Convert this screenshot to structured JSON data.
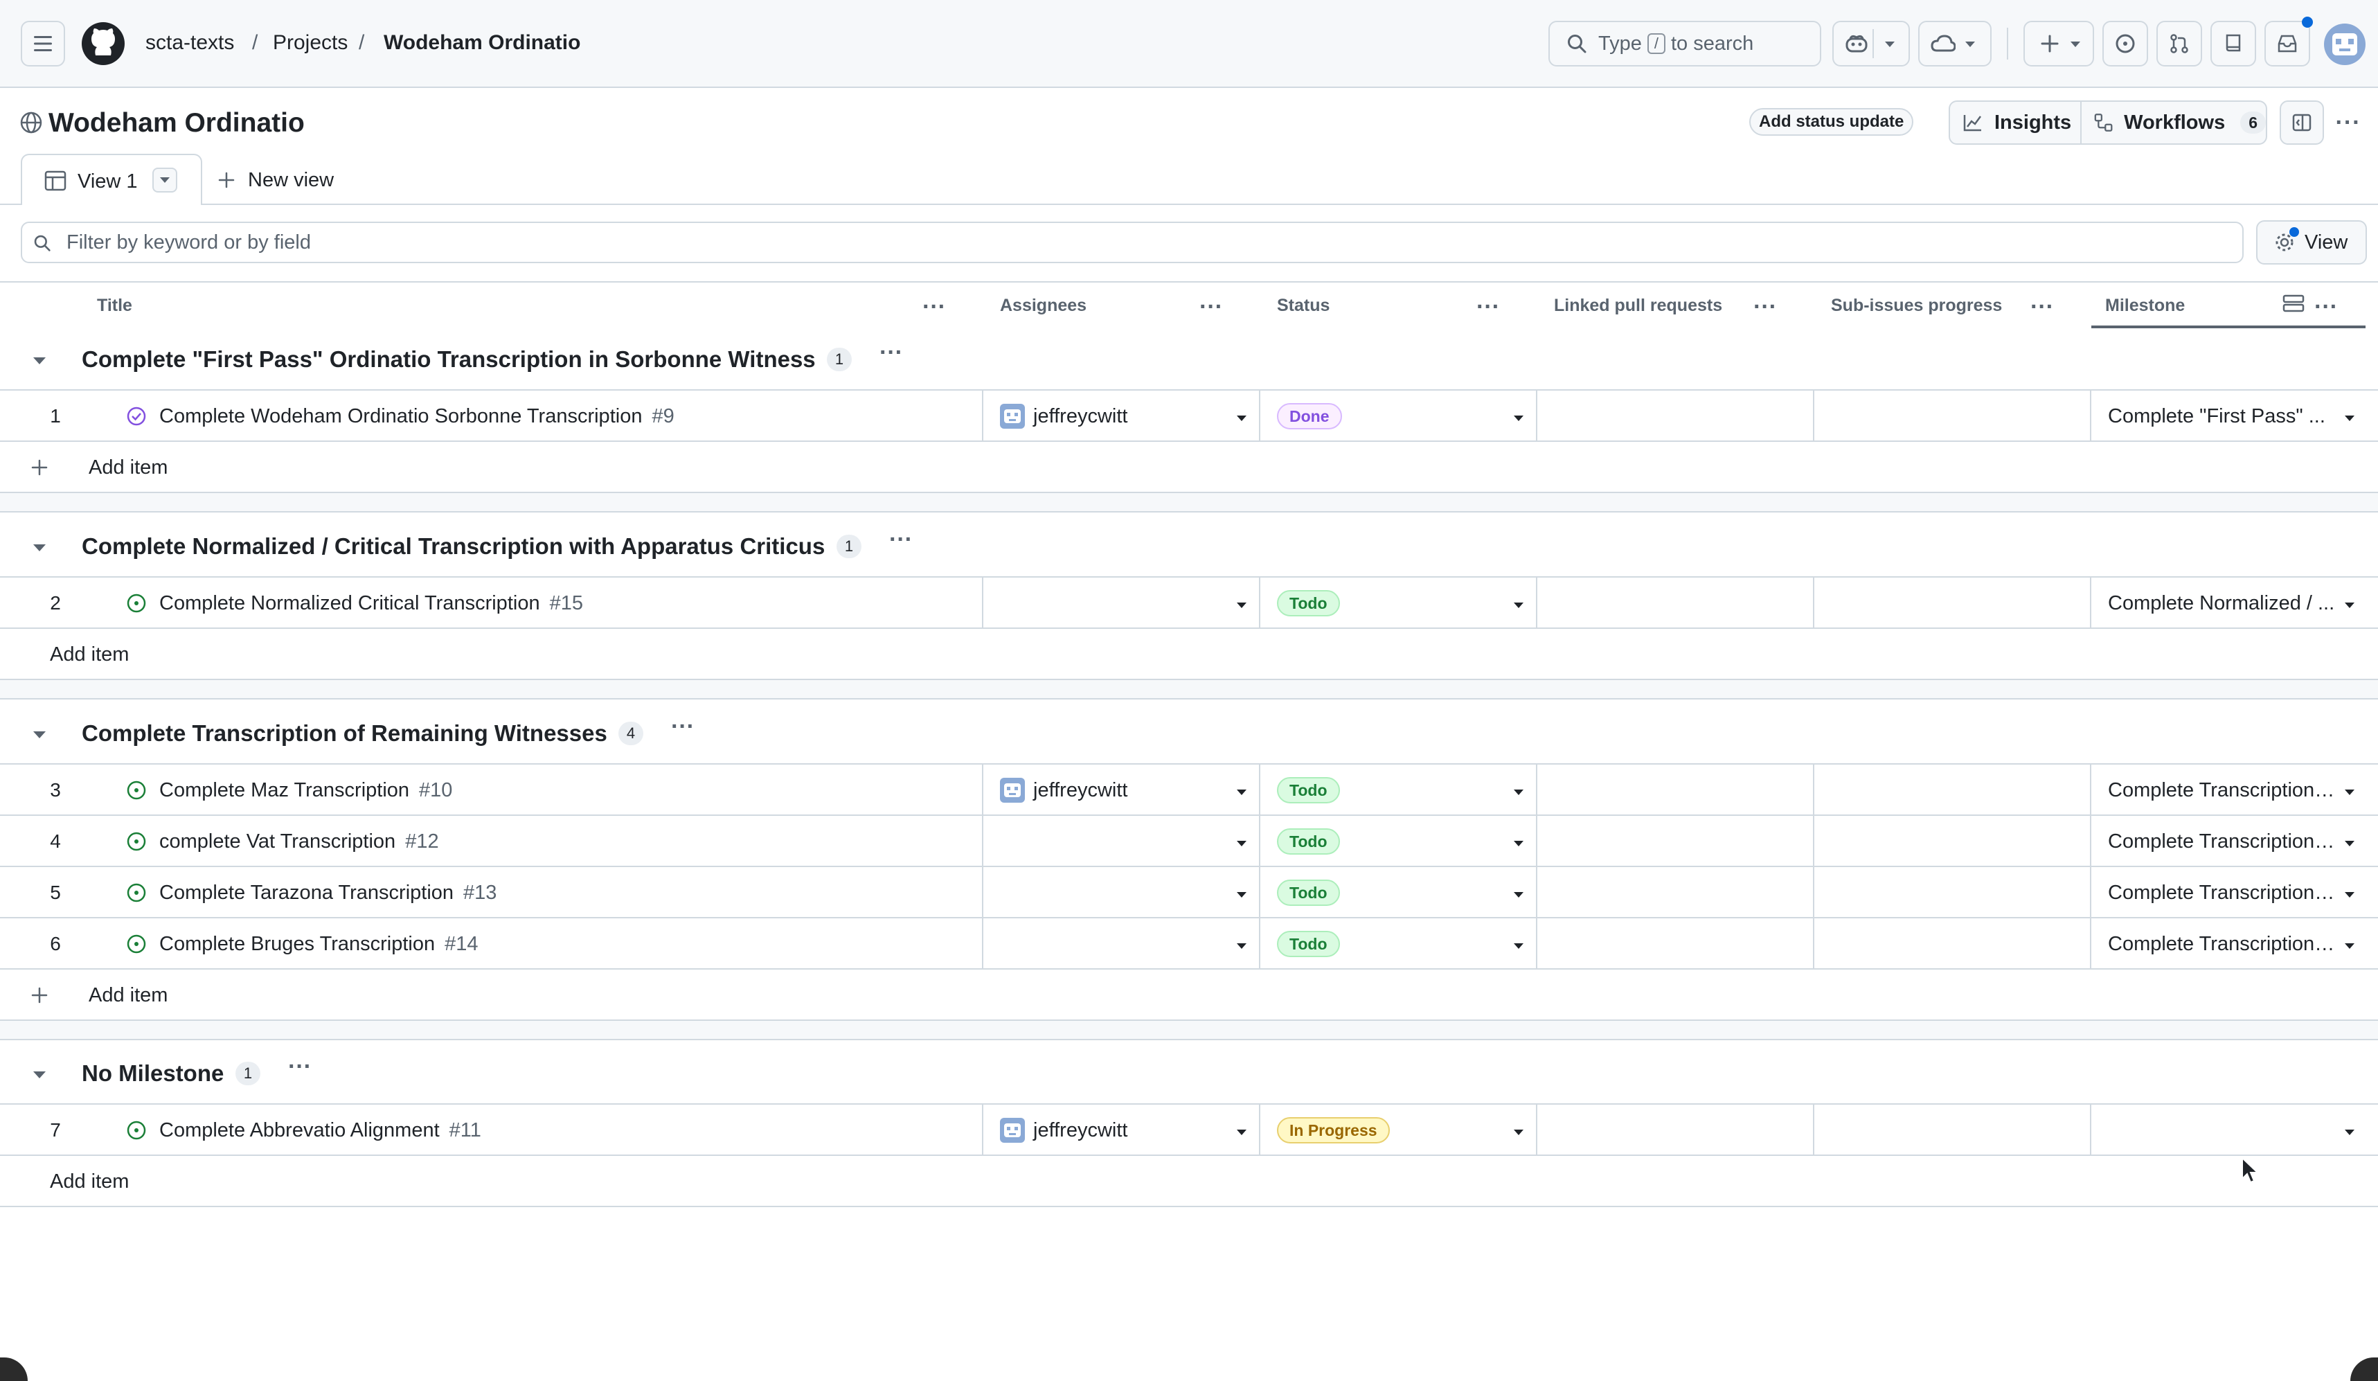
{
  "header": {
    "org": "scta-texts",
    "projects": "Projects",
    "project": "Wodeham Ordinatio",
    "separator": "/",
    "search_prefix": "Type",
    "search_key": "/",
    "search_suffix": "to search"
  },
  "project": {
    "title": "Wodeham Ordinatio",
    "add_status": "Add status update",
    "insights": "Insights",
    "workflows": "Workflows",
    "workflows_count": "6"
  },
  "tabs": {
    "view1": "View 1",
    "new_view": "New view"
  },
  "filter": {
    "placeholder": "Filter by keyword or by field",
    "view_button": "View"
  },
  "columns": {
    "title": "Title",
    "assignees": "Assignees",
    "status": "Status",
    "linked_prs": "Linked pull requests",
    "subissues": "Sub-issues progress",
    "milestone": "Milestone"
  },
  "add_item": "Add item",
  "groups": [
    {
      "title": "Complete \"First Pass\" Ordinatio Transcription in Sorbonne Witness",
      "count": "1",
      "rows": [
        {
          "n": "1",
          "title": "Complete Wodeham Ordinatio Sorbonne Transcription",
          "num": "#9",
          "assignee": "jeffreycwitt",
          "status": "Done",
          "milestone": "Complete \"First Pass\" ..."
        }
      ]
    },
    {
      "title": "Complete Normalized / Critical Transcription with Apparatus Criticus",
      "count": "1",
      "rows": [
        {
          "n": "2",
          "title": "Complete Normalized Critical Transcription",
          "num": "#15",
          "assignee": "",
          "status": "Todo",
          "milestone": "Complete Normalized / ..."
        }
      ]
    },
    {
      "title": "Complete Transcription of Remaining Witnesses",
      "count": "4",
      "rows": [
        {
          "n": "3",
          "title": "Complete Maz Transcription",
          "num": "#10",
          "assignee": "jeffreycwitt",
          "status": "Todo",
          "milestone": "Complete Transcription ..."
        },
        {
          "n": "4",
          "title": "complete Vat Transcription",
          "num": "#12",
          "assignee": "",
          "status": "Todo",
          "milestone": "Complete Transcription ..."
        },
        {
          "n": "5",
          "title": "Complete Tarazona Transcription",
          "num": "#13",
          "assignee": "",
          "status": "Todo",
          "milestone": "Complete Transcription ..."
        },
        {
          "n": "6",
          "title": "Complete Bruges Transcription",
          "num": "#14",
          "assignee": "",
          "status": "Todo",
          "milestone": "Complete Transcription ..."
        }
      ]
    },
    {
      "title": "No Milestone",
      "count": "1",
      "rows": [
        {
          "n": "7",
          "title": "Complete Abbrevatio Alignment",
          "num": "#11",
          "assignee": "jeffreycwitt",
          "status": "In Progress",
          "milestone": ""
        }
      ]
    }
  ],
  "colors": {
    "done": "#8250df",
    "todo": "#1a7f37",
    "in_progress": "#9a6700",
    "border": "#d1d9e0",
    "muted": "#59636e"
  }
}
